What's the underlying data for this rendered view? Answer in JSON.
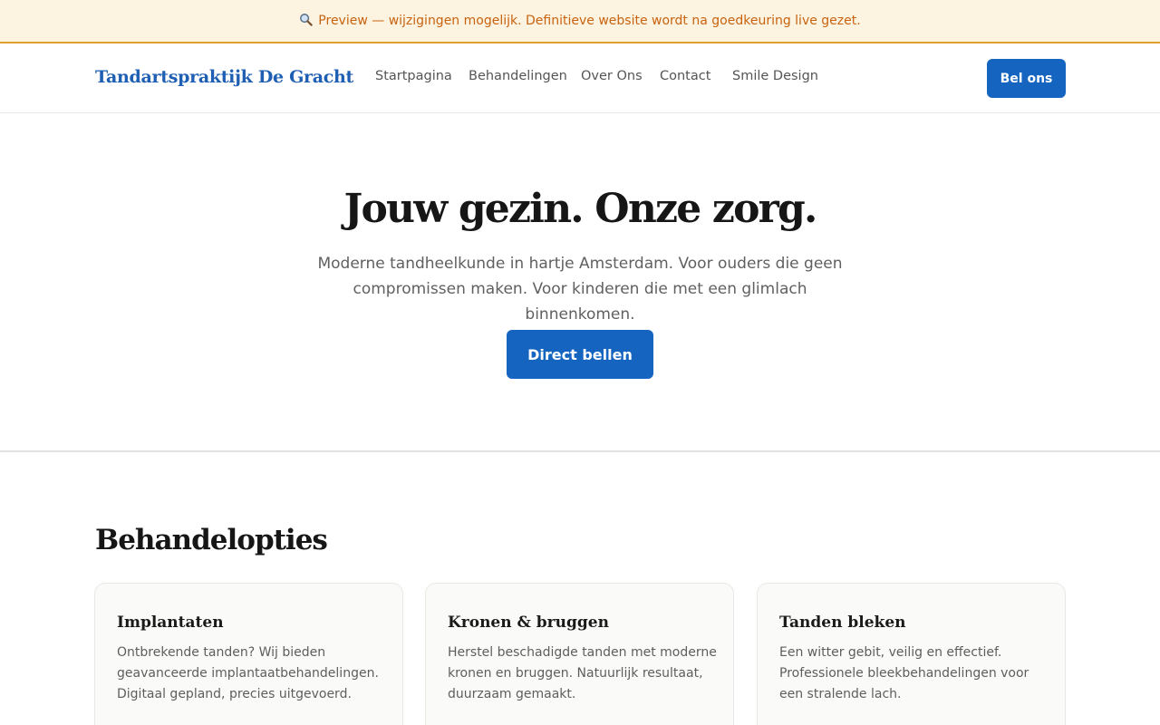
{
  "banner": {
    "icon": "magnifier-icon",
    "text": "Preview — wijzigingen mogelijk. Definitieve website wordt na goedkeuring live gezet."
  },
  "header": {
    "logo": "Tandartspraktijk De Gracht",
    "nav": [
      "Startpagina",
      "Behandelingen",
      "Over Ons",
      "Contact",
      "Smile Design"
    ],
    "cta_label": "Bel ons"
  },
  "hero": {
    "title": "Jouw gezin. Onze zorg.",
    "subtitle": "Moderne tandheelkunde in hartje Amsterdam. Voor ouders die geen compromissen maken. Voor kinderen die met een glimlach binnenkomen.",
    "cta_label": "Direct bellen"
  },
  "treatments": {
    "title": "Behandelopties",
    "cards": [
      {
        "title": "Implantaten",
        "text": "Ontbrekende tanden? Wij bieden geavanceerde implantaatbehandelingen. Digitaal gepland, precies uitgevoerd."
      },
      {
        "title": "Kronen & bruggen",
        "text": "Herstel beschadigde tanden met moderne kronen en bruggen. Natuurlijk resultaat, duurzaam gemaakt."
      },
      {
        "title": "Tanden bleken",
        "text": "Een witter gebit, veilig en effectief. Professionele bleekbehandelingen voor een stralende lach."
      }
    ]
  },
  "colors": {
    "accent": "#1565c0",
    "logo": "#1e5fb3",
    "banner_bg": "#fdf3e1",
    "banner_text": "#c8630f",
    "banner_border": "#e0a030"
  }
}
